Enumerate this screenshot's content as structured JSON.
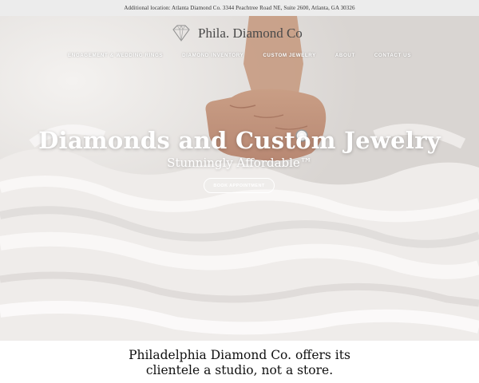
{
  "topbar": {
    "text": "Additional location: Atlanta Diamond Co. 3344 Peachtree Road NE, Suite 2600, Atlanta, GA 30326"
  },
  "header": {
    "logo_text": "Phila. Diamond Co",
    "logo_icon": "diamond-icon",
    "nav": [
      {
        "label": "ENGAGEMENT & WEDDING RINGS"
      },
      {
        "label": "DIAMOND INVENTORY"
      },
      {
        "label": "CUSTOM JEWELRY"
      },
      {
        "label": "ABOUT"
      },
      {
        "label": "CONTACT US"
      }
    ]
  },
  "hero": {
    "headline": "Diamonds and Custom Jewelry",
    "subhead": "Stunningly Affordable™",
    "cta_label": "BOOK APPOINTMENT"
  },
  "intro": {
    "text": "Philadelphia Diamond Co. offers its clientele a studio, not a store."
  }
}
